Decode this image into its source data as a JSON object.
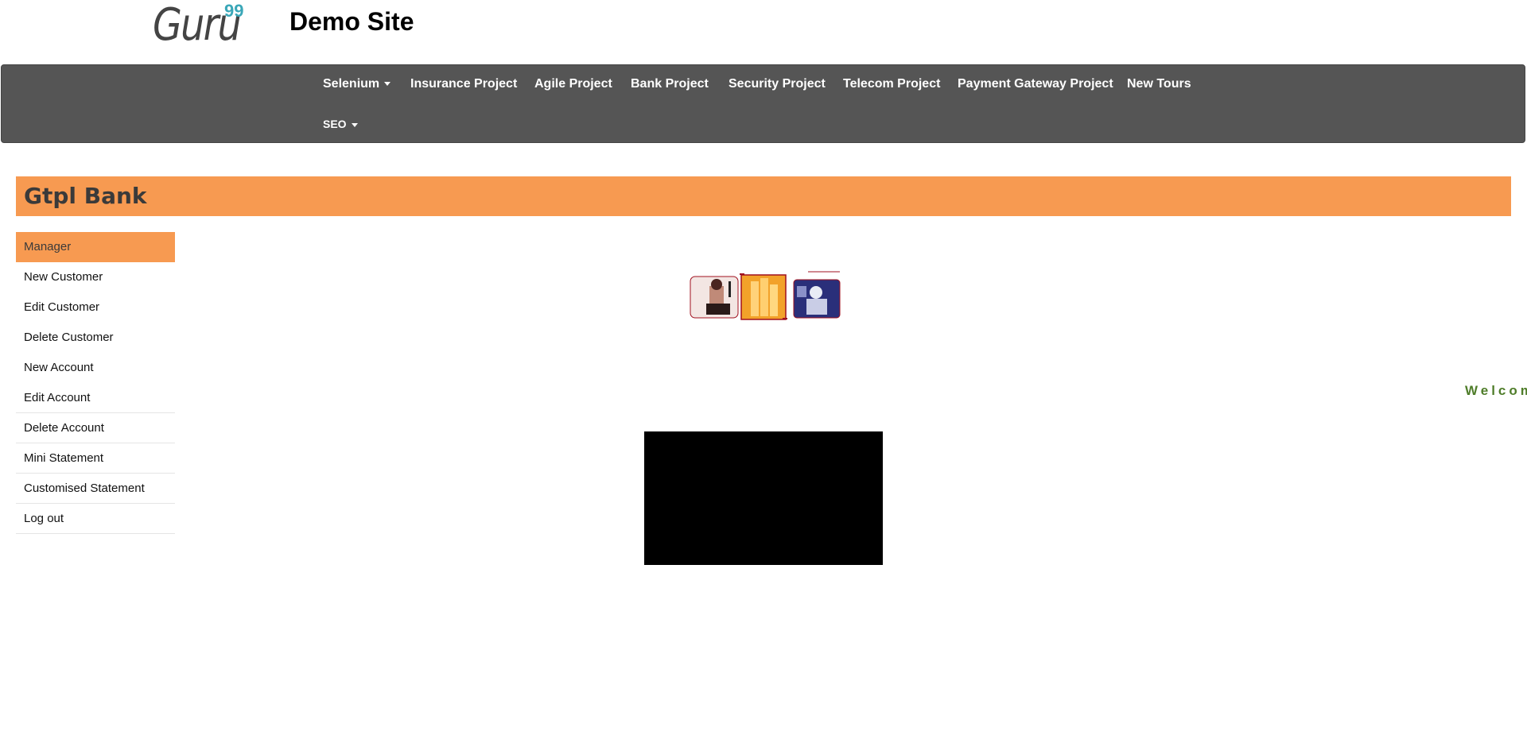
{
  "header": {
    "logo_text": "Guru",
    "logo_sup": "99",
    "site_title": "Demo Site"
  },
  "navbar": {
    "items": [
      {
        "label": "Selenium",
        "dropdown": true
      },
      {
        "label": "Insurance Project"
      },
      {
        "label": "Agile Project"
      },
      {
        "label": "Bank Project"
      },
      {
        "label": "Security Project"
      },
      {
        "label": "Telecom Project"
      },
      {
        "label": "Payment Gateway Project"
      },
      {
        "label": "New Tours"
      },
      {
        "label": "SEO",
        "dropdown": true
      }
    ]
  },
  "bank": {
    "title": "Gtpl Bank"
  },
  "menu": {
    "items": [
      {
        "label": "Manager"
      },
      {
        "label": "New Customer"
      },
      {
        "label": "Edit Customer"
      },
      {
        "label": "Delete Customer"
      },
      {
        "label": "New Account"
      },
      {
        "label": "Edit Account"
      },
      {
        "label": "Delete Account"
      },
      {
        "label": "Mini Statement"
      },
      {
        "label": "Customised Statement"
      },
      {
        "label": "Log out"
      }
    ]
  },
  "main": {
    "welcome_text": "Welcom"
  },
  "colors": {
    "navbar_bg": "#555555",
    "accent": "#f79a51",
    "welcome": "#4f7d2a"
  }
}
